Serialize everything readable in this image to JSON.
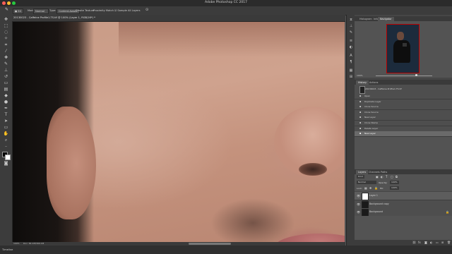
{
  "window": {
    "title": "Adobe Photoshop CC 2017"
  },
  "options_bar": {
    "size": "50",
    "mode_label": "Mode:",
    "mode_value": "Normal",
    "type_label": "Type:",
    "content_aware": "Content-Aware",
    "create_texture": "Create Texture",
    "proximity_match": "Proximity Match",
    "sample_all_layers": "Sample All Layers"
  },
  "document": {
    "tab_label": "20130023 - Caffeine Profile1.TS.tif @ 100% (Layer 1, RGB/16*) *"
  },
  "status": {
    "zoom": "100%",
    "doc_size": "Doc: 84.1M/369.1M"
  },
  "bottom_bar": {
    "label": "Timeline"
  },
  "navigator": {
    "tabs": [
      "Histogram",
      "Info",
      "Navigator"
    ],
    "active_tab": "Navigator",
    "zoom": "100%"
  },
  "history": {
    "tabs": [
      "History",
      "Actions"
    ],
    "snapshot": "20130023 - Caffeine Profile1.TS.tif",
    "items": [
      "Open",
      "Duplicate Layer",
      "Clone Source",
      "Clone Source",
      "New Layer",
      "Clone Stamp",
      "Delete Layer",
      "New Layer"
    ],
    "active_index": 7
  },
  "layers": {
    "tabs": [
      "Layers",
      "Channels",
      "Paths"
    ],
    "kind_label": "Kind",
    "blend_mode": "Normal",
    "opacity_label": "Opacity:",
    "opacity": "100%",
    "lock_label": "Lock:",
    "fill_label": "Fill:",
    "fill": "100%",
    "items": [
      "Layer 1",
      "Background copy",
      "Background"
    ],
    "active_index": 0
  },
  "colors": {
    "accent": "#0a84ff",
    "panel": "#464646",
    "chrome": "#3c3c3c"
  }
}
